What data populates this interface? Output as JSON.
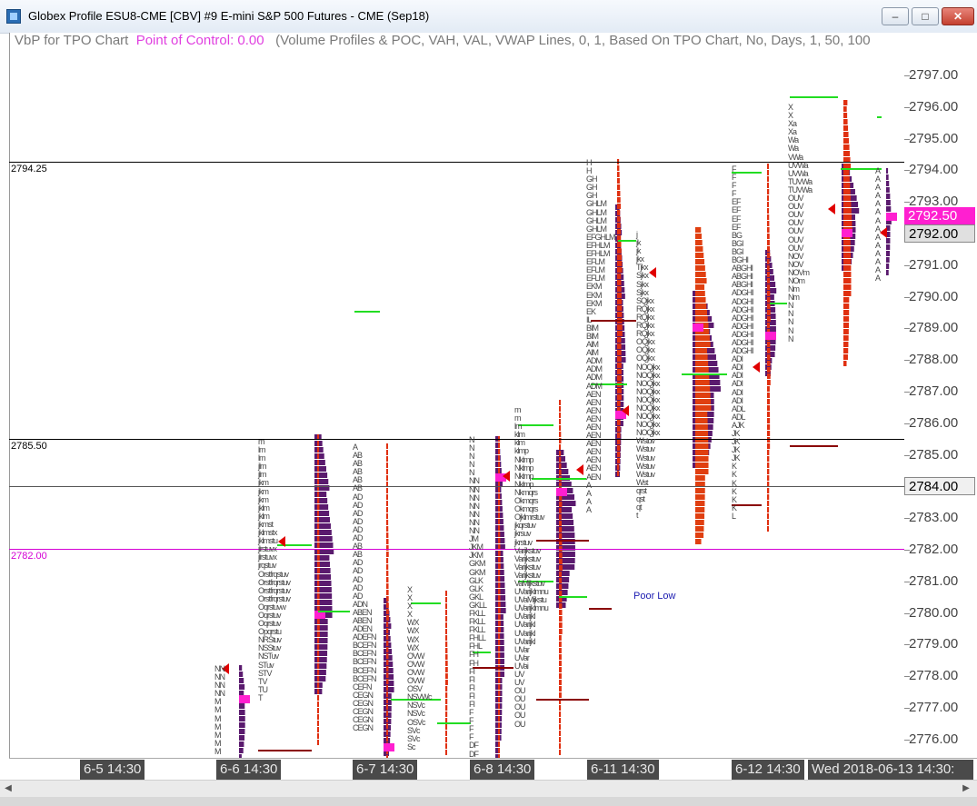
{
  "window": {
    "title": "Globex Profile  ESU8-CME [CBV]  #9  E-mini S&P 500 Futures - CME (Sep18)",
    "minimize_label": "–",
    "maximize_label": "□",
    "close_label": "✕"
  },
  "study": {
    "name": "VbP for TPO Chart",
    "poc_text": "Point of Control: 0.00",
    "params": "(Volume Profiles & POC, VAH, VAL, VWAP Lines, 0, 1, Based On TPO Chart, No, Days, 1, 50, 100"
  },
  "price_axis": {
    "ticks": [
      "2797.00",
      "2796.00",
      "2795.00",
      "2794.00",
      "2793.00",
      "2792.00",
      "2791.00",
      "2790.00",
      "2789.00",
      "2788.00",
      "2787.00",
      "2786.00",
      "2785.00",
      "2784.00",
      "2783.00",
      "2782.00",
      "2781.00",
      "2780.00",
      "2779.00",
      "2778.00",
      "2777.00",
      "2776.00"
    ],
    "current_price": "2792.50",
    "last_price": "2792.00",
    "marker_price": "2784.00",
    "colors": {
      "current": "#ff1fd0",
      "last_bg": "#e8e8e8"
    }
  },
  "reference_lines": [
    {
      "label": "2794.25",
      "color": "#000000"
    },
    {
      "label": "2785.50",
      "color": "#000000"
    },
    {
      "label": "2782.00",
      "color": "#d400d4"
    }
  ],
  "annotation": {
    "text": "Poor Low"
  },
  "date_labels": [
    "6-5  14:30",
    "6-6  14:30",
    "6-7  14:30",
    "6-8  14:30",
    "6-11  14:30",
    "6-12  14:30",
    "Wed 2018-06-13  14:30:"
  ],
  "tpo_columns": [
    {
      "text": "NN\nNN\nNN\nNN\nM\nM\nM\nM\nM\nM\nM"
    },
    {
      "text": "m\nlm\nlm\njlm\njlm\njkm\njkm\njkm\njklm\njklm\njkmst\njklmstx\njklmstu\njlrstuvx\njlrstuvx\njrqstuv\nOrstfrqstuv\nOrstfrqrstuv\nOrstfrqrstuv\nOrstfrqrstuv\nOqrstuvw\nOqrstuv\nOqrstuv\nOpqrstu\nNRStuv\nNSStuv\nNSTuv\nSTuv\nSTV\nTV\nTU\nT"
    },
    {
      "text": "A\nAB\nAB\nAB\nAB\nAB\nAD\nAD\nAD\nAD\nAD\nAD\nAB\nAB\nAD\nAD\nAD\nAD\nAD\nADN\nABEN\nABEN\nADEN\nADEFN\nBCEFN\nBCEFN\nBCEFN\nBCEFN\nBCEFN\nCEFN\nCEGN\nCEGN\nCEGN\nCEGN\nCEGN"
    },
    {
      "text": "X\nX\nX\nX\nWX\nWX\nWX\nWX\nOVW\nOVW\nOVW\nOVW\nOSV\nNSVWc\nNSVc\nNSVc\nOSVc\nSVc\nSVc\nSc"
    },
    {
      "text": "N\nN\nN\nN\nN\nNN\nNN\nNN\nNN\nNN\nNN\nNN\nJM\nJKM\nJKM\nGKM\nGKM\nGLK\nGLK\nGKL\nGKLL\nFKLL\nFKLL\nFKLL\nFHLL\nFHL\nFH\nFH\nFI\nFI\nFI\nFI\nFI\nF\nF\nF\nF\nDF\nDF\nDF\nDF"
    },
    {
      "text": "m\nm\nlm\nklm\nklm\nklmp\nNklmp\nNklmp\nNklmp\nNklmp\nNkmqrs\nOkmqrs\nOkmqrs\nOjklmrstuv\njkqrstuv\njkrsuv\njkrstuv\nVarijkstuv\nVarijkstuv\nVarijkstuv\nVarijkstuv\nVaMijkstuv\nUVarijklmnu\nUVaMijkstu\nUVarijklmnu\nUVarijkl\nUVarijkl\nUVarijkl\nUVarijkl\nUVar\nUVar\nUVai\nUV\nUV\nOU\nOU\nOU\nOU\nOU"
    },
    {
      "text": "H\nH\nGH\nGH\nGH\nGHLM\nGHLM\nGHLM\nGHLM\nEFGHLM\nEFHLM\nEFHLM\nEFLM\nEFLM\nEFLM\nEKM\nEKM\nEKM\nEK\nIL\nBIM\nBIM\nAIM\nAIM\nADM\nADM\nADM\nADM\nAEN\nAEN\nAEN\nAEN\nAEN\nAEN\nAEN\nAEN\nAEN\nAEN\nAEN\nA\nA\nA\nA"
    },
    {
      "text": "j\njk\njk\njkx\nTjkx\nSjkx\nSjkx\nSjkx\nSQjkx\nRQjkx\nRQjkx\nRQjkx\nRQjkx\nOQjkx\nOQjkx\nOQjkx\nNOQjkx\nNOQjkx\nNOQjkx\nNOQjkx\nNOQjkx\nNOQjkx\nNOQjkx\nNOQjkx\nNOQjkx\nWstuv\nWstuv\nWstuv\nWstuv\nWstuv\nWst\nqrst\nqst\nqt\nt"
    },
    {
      "text": "F\nF\nF\nF\nEF\nEF\nEF\nEF\nBG\nBGI\nBGI\nBGHI\nABGHI\nABGHI\nABGHI\nADGHI\nADGHI\nADGHI\nADGHI\nADGHI\nADGHI\nADGHI\nADGHI\nADI\nADI\nADI\nADI\nADI\nADI\nADL\nADL\nAJK\nJK\nJK\nJK\nJK\nK\nK\nK\nK\nK\nK\nL"
    },
    {
      "text": "X\nX\nXa\nXa\nWa\nWa\nVWa\nUVWa\nUVWa\nTUVWa\nTUVWa\nOUV\nOUV\nOUV\nOUV\nOUV\nOUV\nOUV\nNOV\nNOV\nNOVm\nNOm\nNm\nNm\nN\nN\nN\nN\nN"
    },
    {
      "text": "A\nA\nA\nA\nA\nA\nA\nA\nA\nA\nA\nA\nA\nA"
    }
  ]
}
